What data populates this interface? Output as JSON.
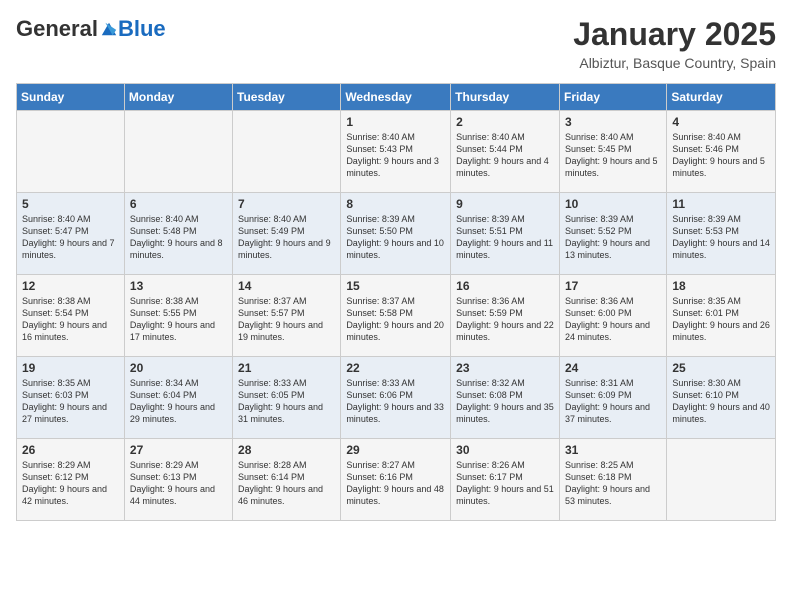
{
  "header": {
    "logo_general": "General",
    "logo_blue": "Blue",
    "month_title": "January 2025",
    "location": "Albiztur, Basque Country, Spain"
  },
  "columns": [
    "Sunday",
    "Monday",
    "Tuesday",
    "Wednesday",
    "Thursday",
    "Friday",
    "Saturday"
  ],
  "weeks": [
    [
      {
        "day": "",
        "info": ""
      },
      {
        "day": "",
        "info": ""
      },
      {
        "day": "",
        "info": ""
      },
      {
        "day": "1",
        "info": "Sunrise: 8:40 AM\nSunset: 5:43 PM\nDaylight: 9 hours and 3 minutes."
      },
      {
        "day": "2",
        "info": "Sunrise: 8:40 AM\nSunset: 5:44 PM\nDaylight: 9 hours and 4 minutes."
      },
      {
        "day": "3",
        "info": "Sunrise: 8:40 AM\nSunset: 5:45 PM\nDaylight: 9 hours and 5 minutes."
      },
      {
        "day": "4",
        "info": "Sunrise: 8:40 AM\nSunset: 5:46 PM\nDaylight: 9 hours and 5 minutes."
      }
    ],
    [
      {
        "day": "5",
        "info": "Sunrise: 8:40 AM\nSunset: 5:47 PM\nDaylight: 9 hours and 7 minutes."
      },
      {
        "day": "6",
        "info": "Sunrise: 8:40 AM\nSunset: 5:48 PM\nDaylight: 9 hours and 8 minutes."
      },
      {
        "day": "7",
        "info": "Sunrise: 8:40 AM\nSunset: 5:49 PM\nDaylight: 9 hours and 9 minutes."
      },
      {
        "day": "8",
        "info": "Sunrise: 8:39 AM\nSunset: 5:50 PM\nDaylight: 9 hours and 10 minutes."
      },
      {
        "day": "9",
        "info": "Sunrise: 8:39 AM\nSunset: 5:51 PM\nDaylight: 9 hours and 11 minutes."
      },
      {
        "day": "10",
        "info": "Sunrise: 8:39 AM\nSunset: 5:52 PM\nDaylight: 9 hours and 13 minutes."
      },
      {
        "day": "11",
        "info": "Sunrise: 8:39 AM\nSunset: 5:53 PM\nDaylight: 9 hours and 14 minutes."
      }
    ],
    [
      {
        "day": "12",
        "info": "Sunrise: 8:38 AM\nSunset: 5:54 PM\nDaylight: 9 hours and 16 minutes."
      },
      {
        "day": "13",
        "info": "Sunrise: 8:38 AM\nSunset: 5:55 PM\nDaylight: 9 hours and 17 minutes."
      },
      {
        "day": "14",
        "info": "Sunrise: 8:37 AM\nSunset: 5:57 PM\nDaylight: 9 hours and 19 minutes."
      },
      {
        "day": "15",
        "info": "Sunrise: 8:37 AM\nSunset: 5:58 PM\nDaylight: 9 hours and 20 minutes."
      },
      {
        "day": "16",
        "info": "Sunrise: 8:36 AM\nSunset: 5:59 PM\nDaylight: 9 hours and 22 minutes."
      },
      {
        "day": "17",
        "info": "Sunrise: 8:36 AM\nSunset: 6:00 PM\nDaylight: 9 hours and 24 minutes."
      },
      {
        "day": "18",
        "info": "Sunrise: 8:35 AM\nSunset: 6:01 PM\nDaylight: 9 hours and 26 minutes."
      }
    ],
    [
      {
        "day": "19",
        "info": "Sunrise: 8:35 AM\nSunset: 6:03 PM\nDaylight: 9 hours and 27 minutes."
      },
      {
        "day": "20",
        "info": "Sunrise: 8:34 AM\nSunset: 6:04 PM\nDaylight: 9 hours and 29 minutes."
      },
      {
        "day": "21",
        "info": "Sunrise: 8:33 AM\nSunset: 6:05 PM\nDaylight: 9 hours and 31 minutes."
      },
      {
        "day": "22",
        "info": "Sunrise: 8:33 AM\nSunset: 6:06 PM\nDaylight: 9 hours and 33 minutes."
      },
      {
        "day": "23",
        "info": "Sunrise: 8:32 AM\nSunset: 6:08 PM\nDaylight: 9 hours and 35 minutes."
      },
      {
        "day": "24",
        "info": "Sunrise: 8:31 AM\nSunset: 6:09 PM\nDaylight: 9 hours and 37 minutes."
      },
      {
        "day": "25",
        "info": "Sunrise: 8:30 AM\nSunset: 6:10 PM\nDaylight: 9 hours and 40 minutes."
      }
    ],
    [
      {
        "day": "26",
        "info": "Sunrise: 8:29 AM\nSunset: 6:12 PM\nDaylight: 9 hours and 42 minutes."
      },
      {
        "day": "27",
        "info": "Sunrise: 8:29 AM\nSunset: 6:13 PM\nDaylight: 9 hours and 44 minutes."
      },
      {
        "day": "28",
        "info": "Sunrise: 8:28 AM\nSunset: 6:14 PM\nDaylight: 9 hours and 46 minutes."
      },
      {
        "day": "29",
        "info": "Sunrise: 8:27 AM\nSunset: 6:16 PM\nDaylight: 9 hours and 48 minutes."
      },
      {
        "day": "30",
        "info": "Sunrise: 8:26 AM\nSunset: 6:17 PM\nDaylight: 9 hours and 51 minutes."
      },
      {
        "day": "31",
        "info": "Sunrise: 8:25 AM\nSunset: 6:18 PM\nDaylight: 9 hours and 53 minutes."
      },
      {
        "day": "",
        "info": ""
      }
    ]
  ]
}
